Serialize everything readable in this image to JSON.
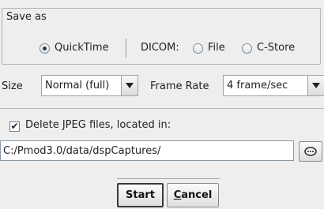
{
  "save_as": {
    "title": "Save as",
    "quicktime_label": "QuickTime",
    "quicktime_selected": true,
    "dicom_label": "DICOM:",
    "file_label": "File",
    "file_selected": false,
    "cstore_label": "C-Store",
    "cstore_selected": false
  },
  "size": {
    "label": "Size",
    "value": "Normal (full)"
  },
  "frame_rate": {
    "label": "Frame Rate",
    "value": "4 frame/sec"
  },
  "delete_jpeg": {
    "label": "Delete JPEG files, located in:",
    "checked": true,
    "check_glyph": "✔"
  },
  "path": {
    "value": "C:/Pmod3.0/data/dspCaptures/"
  },
  "browse_icon": "ellipsis-icon",
  "buttons": {
    "start_label": "Start",
    "cancel_mnemonic": "C",
    "cancel_rest": "ancel"
  }
}
